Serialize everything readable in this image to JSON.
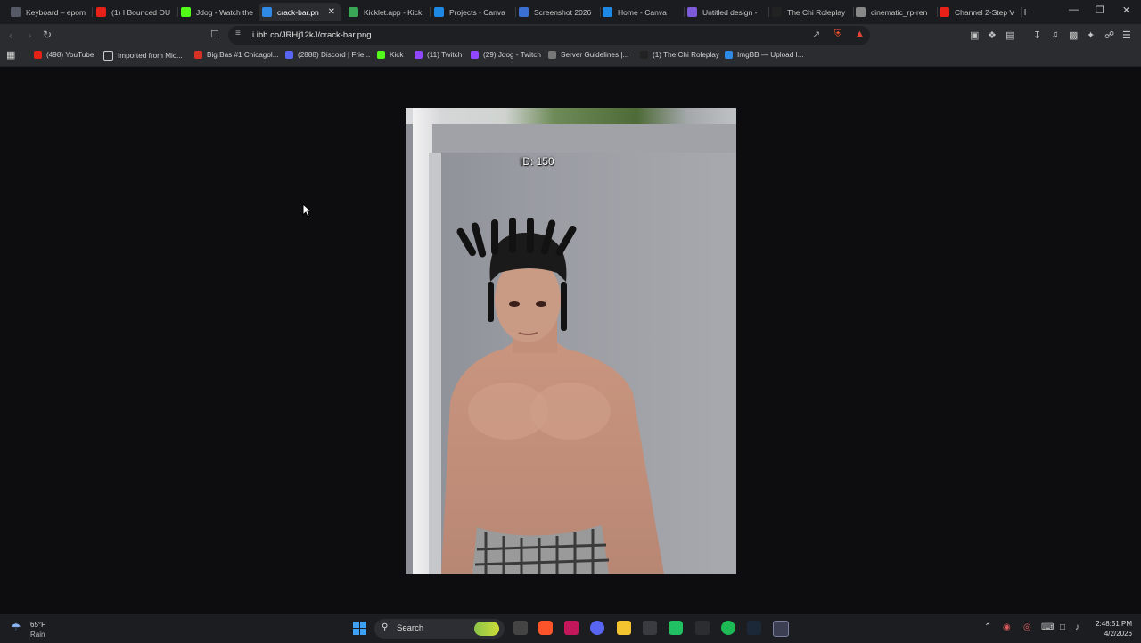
{
  "browser": {
    "tabs": [
      {
        "label": "Keyboard – epom",
        "color": "#555a66"
      },
      {
        "label": "(1) I Bounced OU",
        "color": "#e62117"
      },
      {
        "label": "Jdog - Watch the",
        "color": "#53fc18"
      },
      {
        "label": "crack-bar.pn",
        "color": "#2f8ae5",
        "active": true
      },
      {
        "label": "Kicklet.app - Kick",
        "color": "#3aa757"
      },
      {
        "label": "Projects - Canva",
        "color": "#1e88e5"
      },
      {
        "label": "Screenshot 2026",
        "color": "#3b6fd1"
      },
      {
        "label": "Home - Canva",
        "color": "#1e88e5"
      },
      {
        "label": "Untitled design -",
        "color": "#7d5bd8"
      },
      {
        "label": "The Chi Roleplay",
        "color": "#222222"
      },
      {
        "label": "cinematic_rp-ren",
        "color": "#888888"
      },
      {
        "label": "Channel 2-Step V",
        "color": "#e62117"
      }
    ],
    "url": "i.ibb.co/JRHj12kJ/crack-bar.png",
    "bookmarks": [
      {
        "label": "(498) YouTube",
        "color": "#e62117"
      },
      {
        "label": "Imported from Mic...",
        "color": "#2b2c30"
      },
      {
        "label": "Big Bas #1 Chicagol...",
        "color": "#d93025"
      },
      {
        "label": "(2888) Discord | Frie...",
        "color": "#5865f2"
      },
      {
        "label": "Kick",
        "color": "#53fc18"
      },
      {
        "label": "(11) Twitch",
        "color": "#9146ff"
      },
      {
        "label": "(29) Jdog - Twitch",
        "color": "#9146ff"
      },
      {
        "label": "Server Guidelines |...",
        "color": "#777777"
      },
      {
        "label": "(1) The Chi Roleplay",
        "color": "#222222"
      },
      {
        "label": "ImgBB — Upload I...",
        "color": "#2f8ae5"
      }
    ]
  },
  "image": {
    "overlay_text": "ID: 150"
  },
  "taskbar": {
    "weather_temp": "65°F",
    "weather_desc": "Rain",
    "search_label": "Search",
    "time": "2:48:51 PM",
    "date": "4/2/2026"
  }
}
